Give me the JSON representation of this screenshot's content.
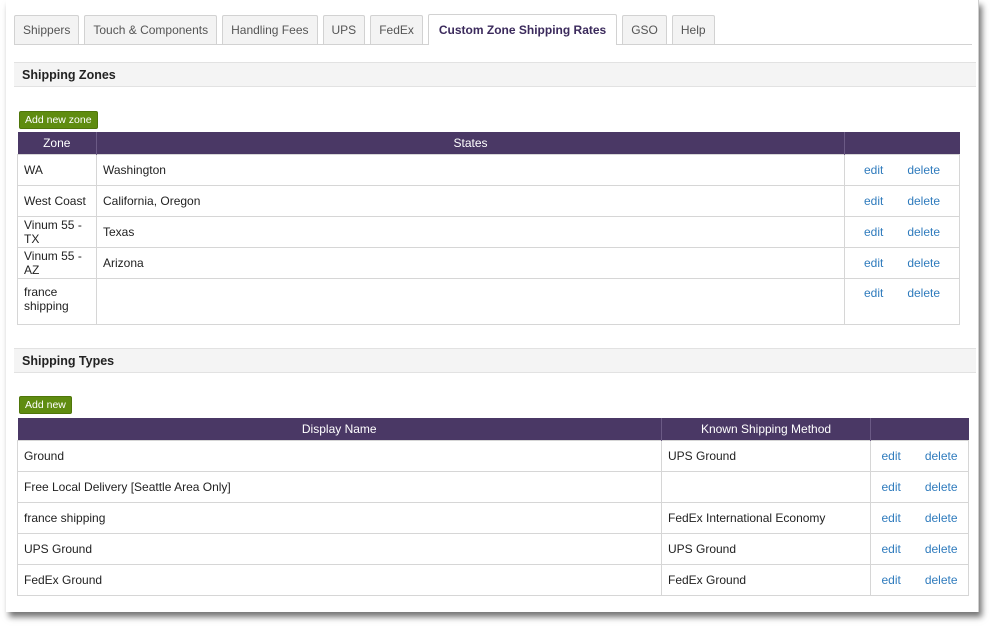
{
  "tabs": [
    {
      "label": "Shippers",
      "active": false
    },
    {
      "label": "Touch & Components",
      "active": false
    },
    {
      "label": "Handling Fees",
      "active": false
    },
    {
      "label": "UPS",
      "active": false
    },
    {
      "label": "FedEx",
      "active": false
    },
    {
      "label": "Custom Zone Shipping Rates",
      "active": true
    },
    {
      "label": "GSO",
      "active": false
    },
    {
      "label": "Help",
      "active": false
    }
  ],
  "zones": {
    "title": "Shipping Zones",
    "add_label": "Add new zone",
    "columns": [
      "Zone",
      "States",
      ""
    ],
    "rows": [
      {
        "zone": "WA",
        "states": "Washington",
        "edit": "edit",
        "delete": "delete"
      },
      {
        "zone": "West Coast",
        "states": "California, Oregon",
        "edit": "edit",
        "delete": "delete"
      },
      {
        "zone": "Vinum 55 - TX",
        "states": "Texas",
        "edit": "edit",
        "delete": "delete"
      },
      {
        "zone": "Vinum 55 - AZ",
        "states": "Arizona",
        "edit": "edit",
        "delete": "delete"
      },
      {
        "zone": "france shipping",
        "states": "",
        "edit": "edit",
        "delete": "delete"
      }
    ]
  },
  "types": {
    "title": "Shipping Types",
    "add_label": "Add new",
    "columns": [
      "Display Name",
      "Known Shipping Method",
      ""
    ],
    "rows": [
      {
        "name": "Ground",
        "method": "UPS Ground",
        "edit": "edit",
        "delete": "delete"
      },
      {
        "name": "Free Local Delivery [Seattle Area Only]",
        "method": "",
        "edit": "edit",
        "delete": "delete"
      },
      {
        "name": "france shipping",
        "method": "FedEx International Economy",
        "edit": "edit",
        "delete": "delete"
      },
      {
        "name": "UPS Ground",
        "method": "UPS Ground",
        "edit": "edit",
        "delete": "delete"
      },
      {
        "name": "FedEx Ground",
        "method": "FedEx Ground",
        "edit": "edit",
        "delete": "delete"
      }
    ]
  },
  "colors": {
    "header": "#4a3865",
    "button": "#5f8c10",
    "link": "#2f7bbd"
  }
}
